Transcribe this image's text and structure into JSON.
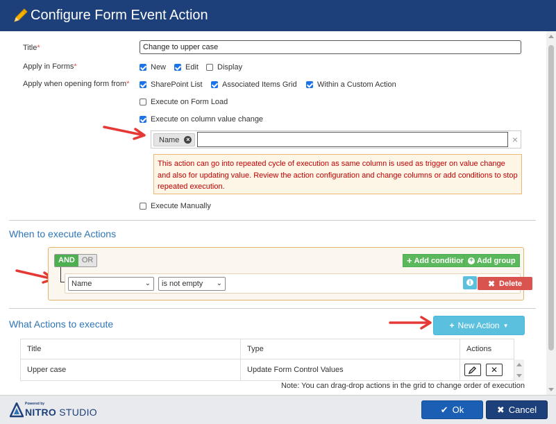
{
  "window": {
    "title": "Configure Form Event Action"
  },
  "form": {
    "title_label": "Title",
    "title_value": "Change to upper case",
    "apply_forms_label": "Apply in Forms",
    "apply_forms_options": [
      {
        "label": "New",
        "checked": true
      },
      {
        "label": "Edit",
        "checked": true
      },
      {
        "label": "Display",
        "checked": false
      }
    ],
    "apply_opening_label": "Apply when opening form from",
    "apply_opening_options": [
      {
        "label": "SharePoint List",
        "checked": true
      },
      {
        "label": "Associated Items Grid",
        "checked": true
      },
      {
        "label": "Within a Custom Action",
        "checked": true
      }
    ],
    "execute_on_form_load": {
      "label": "Execute on Form Load",
      "checked": false
    },
    "execute_on_column_change": {
      "label": "Execute on column value change",
      "checked": true
    },
    "column_tags": [
      "Name"
    ],
    "clear_symbol": "×",
    "warning_text": "This action can go into repeated cycle of execution as same column is used as trigger on value change and also for updating value. Review the action configuration and change columns or add conditions to stop repeated execution.",
    "execute_manually": {
      "label": "Execute Manually",
      "checked": false
    },
    "required_marker": "*"
  },
  "conditions": {
    "section_title": "When to execute Actions",
    "and_label": "AND",
    "or_label": "OR",
    "add_condition_label": "Add condition",
    "add_group_label": "Add group",
    "rule": {
      "field": "Name",
      "operator": "is not empty",
      "delete_label": "Delete"
    }
  },
  "actions": {
    "section_title": "What Actions to execute",
    "new_action_label": "New Action",
    "columns": [
      "Title",
      "Type",
      "Actions"
    ],
    "rows": [
      {
        "title": "Upper case",
        "type": "Update Form Control Values"
      }
    ],
    "note": "Note: You can drag-drop actions in the grid to change order of execution"
  },
  "footer": {
    "powered_by": "Powered by",
    "brand_name": "NITRO",
    "brand_suffix": "STUDIO",
    "ok_label": "Ok",
    "cancel_label": "Cancel"
  },
  "colors": {
    "header": "#1d3f7a",
    "accent_blue": "#2e75b6",
    "green": "#5cb85c",
    "danger": "#d9534f",
    "info": "#5bc0de",
    "arrow_red": "#e53935"
  }
}
